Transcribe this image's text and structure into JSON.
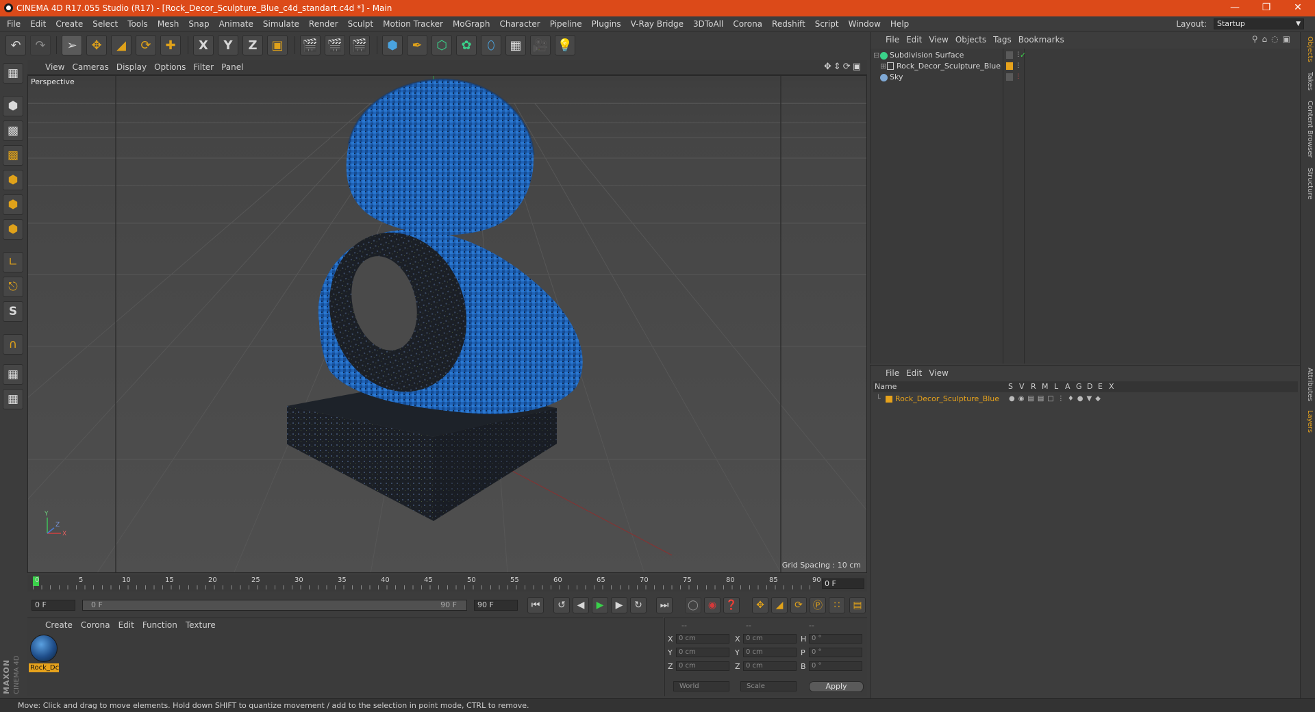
{
  "window": {
    "title": "CINEMA 4D R17.055 Studio (R17) - [Rock_Decor_Sculpture_Blue_c4d_standart.c4d *] - Main"
  },
  "menubar": {
    "items": [
      "File",
      "Edit",
      "Create",
      "Select",
      "Tools",
      "Mesh",
      "Snap",
      "Animate",
      "Simulate",
      "Render",
      "Sculpt",
      "Motion Tracker",
      "MoGraph",
      "Character",
      "Pipeline",
      "Plugins",
      "V-Ray Bridge",
      "3DToAll",
      "Corona",
      "Redshift",
      "Script",
      "Window",
      "Help"
    ],
    "layout_label": "Layout:",
    "layout_value": "Startup"
  },
  "toolbar": {
    "axis_x": "X",
    "axis_y": "Y",
    "axis_z": "Z"
  },
  "left_tools": {
    "snap_letter": "S"
  },
  "viewport": {
    "menus": [
      "View",
      "Cameras",
      "Display",
      "Options",
      "Filter",
      "Panel"
    ],
    "label": "Perspective",
    "grid_spacing": "Grid Spacing : 10 cm",
    "axis_y": "Y",
    "axis_x": "X",
    "axis_z": "Z"
  },
  "timeline": {
    "ticks": [
      "0",
      "5",
      "10",
      "15",
      "20",
      "25",
      "30",
      "35",
      "40",
      "45",
      "50",
      "55",
      "60",
      "65",
      "70",
      "75",
      "80",
      "85",
      "90"
    ],
    "end_frame": "0 F"
  },
  "playbar": {
    "start_field": "0 F",
    "range_start": "0 F",
    "range_end": "90 F",
    "end_field": "90 F"
  },
  "material_manager": {
    "menus": [
      "Create",
      "Corona",
      "Edit",
      "Function",
      "Texture"
    ],
    "material_name": "Rock_Dc"
  },
  "coordinates": {
    "header": [
      "--",
      "--",
      "--"
    ],
    "rows": [
      {
        "l1": "X",
        "v1": "0 cm",
        "l2": "X",
        "v2": "0 cm",
        "l3": "H",
        "v3": "0 °"
      },
      {
        "l1": "Y",
        "v1": "0 cm",
        "l2": "Y",
        "v2": "0 cm",
        "l3": "P",
        "v3": "0 °"
      },
      {
        "l1": "Z",
        "v1": "0 cm",
        "l2": "Z",
        "v2": "0 cm",
        "l3": "B",
        "v3": "0 °"
      }
    ],
    "space_select": "World",
    "mode_select": "Scale",
    "apply_label": "Apply"
  },
  "object_manager": {
    "menus": [
      "File",
      "Edit",
      "View",
      "Objects",
      "Tags",
      "Bookmarks"
    ],
    "objects": [
      {
        "name": "Subdivision Surface",
        "icon_color": "#3ad28a"
      },
      {
        "name": "Rock_Decor_Sculpture_Blue",
        "icon_color": "#9a9a9a"
      },
      {
        "name": "Sky",
        "icon_color": "#7fa9d6"
      }
    ]
  },
  "layer_manager": {
    "menus": [
      "File",
      "Edit",
      "View"
    ],
    "columns": [
      "Name",
      "S",
      "V",
      "R",
      "M",
      "L",
      "A",
      "G",
      "D",
      "E",
      "X"
    ],
    "layer_name": "Rock_Decor_Sculpture_Blue",
    "layer_color": "#e6a21c"
  },
  "side_tabs": {
    "top": [
      "Objects",
      "Takes",
      "Content Browser",
      "Structure"
    ],
    "bottom": [
      "Attributes",
      "Layers"
    ]
  },
  "brand": {
    "maxon": "MAXON",
    "product": "CINEMA 4D"
  },
  "statusbar": {
    "text": "Move: Click and drag to move elements. Hold down SHIFT to quantize movement / add to the selection in point mode, CTRL to remove."
  }
}
